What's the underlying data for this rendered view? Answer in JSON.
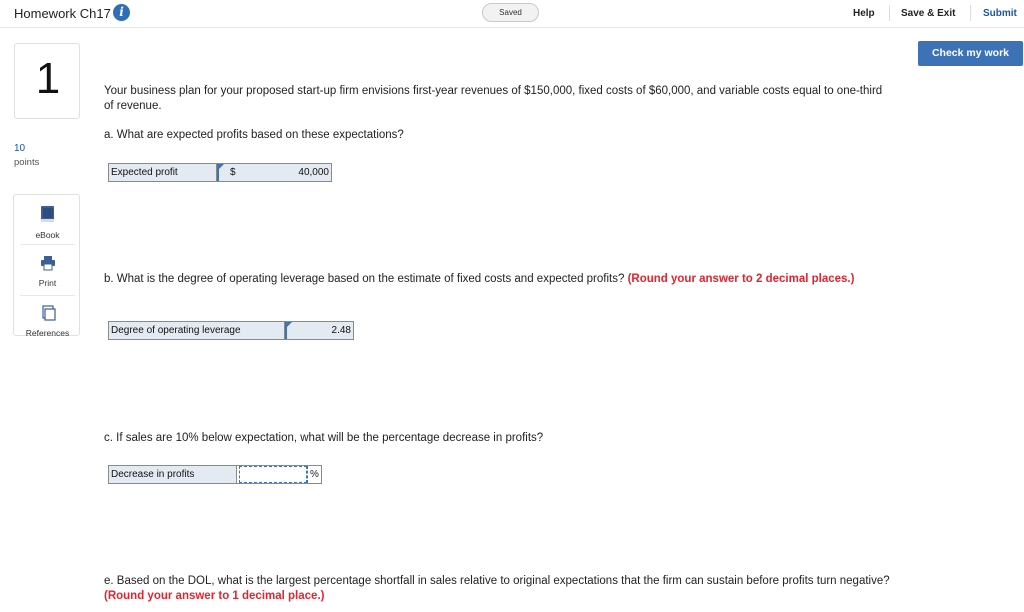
{
  "header": {
    "title": "Homework Ch17",
    "info_icon": "info-icon",
    "status": "Saved",
    "help": "Help",
    "save_exit": "Save & Exit",
    "submit": "Submit",
    "check_work": "Check my work"
  },
  "question": {
    "number": "1",
    "points_value": "10",
    "points_label": "points"
  },
  "tools": [
    {
      "label": "eBook",
      "icon": "book-icon"
    },
    {
      "label": "Print",
      "icon": "printer-icon"
    },
    {
      "label": "References",
      "icon": "references-icon"
    }
  ],
  "content": {
    "intro": "Your business plan for your proposed start-up firm envisions first-year revenues of $150,000, fixed costs of $60,000, and variable costs equal to one-third of revenue.",
    "a_prompt": "a. What are expected profits based on these expectations?",
    "a_label": "Expected profit",
    "a_currency": "$",
    "a_value": "40,000",
    "b_prompt": "b. What is the degree of operating leverage based on the estimate of fixed costs and expected profits?",
    "b_note": "(Round your answer to 2 decimal places.)",
    "b_label": "Degree of operating leverage",
    "b_value": "2.48",
    "c_prompt": "c. If sales are 10% below expectation, what will be the percentage decrease in profits?",
    "c_label": "Decrease in profits",
    "c_value": "",
    "c_unit": "%",
    "e_prompt": "e. Based on the DOL, what is the largest percentage shortfall in sales relative to original expectations that the firm can sustain before profits turn negative?",
    "e_note": "(Round your answer to 1 decimal place.)"
  },
  "colors": {
    "accent": "#3d73b6",
    "note_red": "#e3232e",
    "answer_bg": "#e4eaf2"
  }
}
